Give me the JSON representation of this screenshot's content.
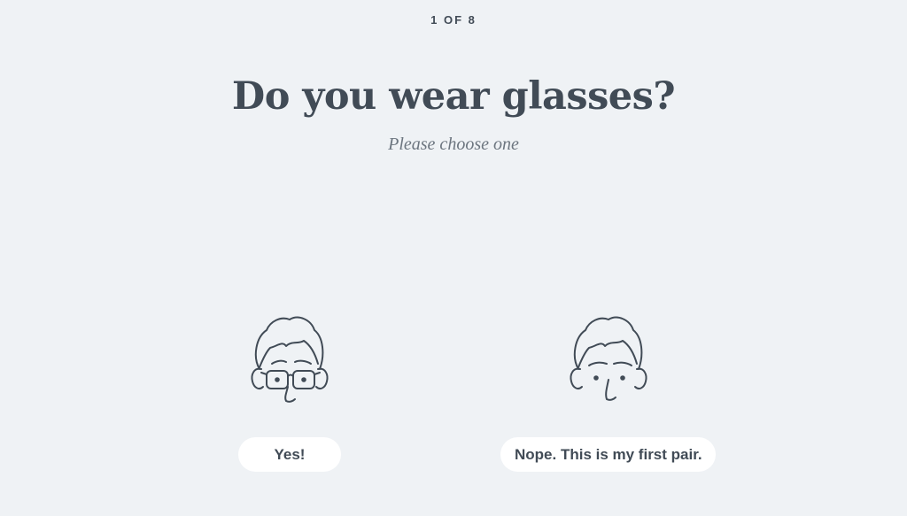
{
  "quiz": {
    "progress": "1 OF 8",
    "question": "Do you wear glasses?",
    "instruction": "Please choose one",
    "options": [
      {
        "label": "Yes!",
        "illustration": "face-with-glasses-icon"
      },
      {
        "label": "Nope. This is my first pair.",
        "illustration": "face-without-glasses-icon"
      }
    ]
  },
  "colors": {
    "background": "#eff2f5",
    "text": "#414b56",
    "subtext": "#6c757f",
    "button": "#ffffff"
  }
}
